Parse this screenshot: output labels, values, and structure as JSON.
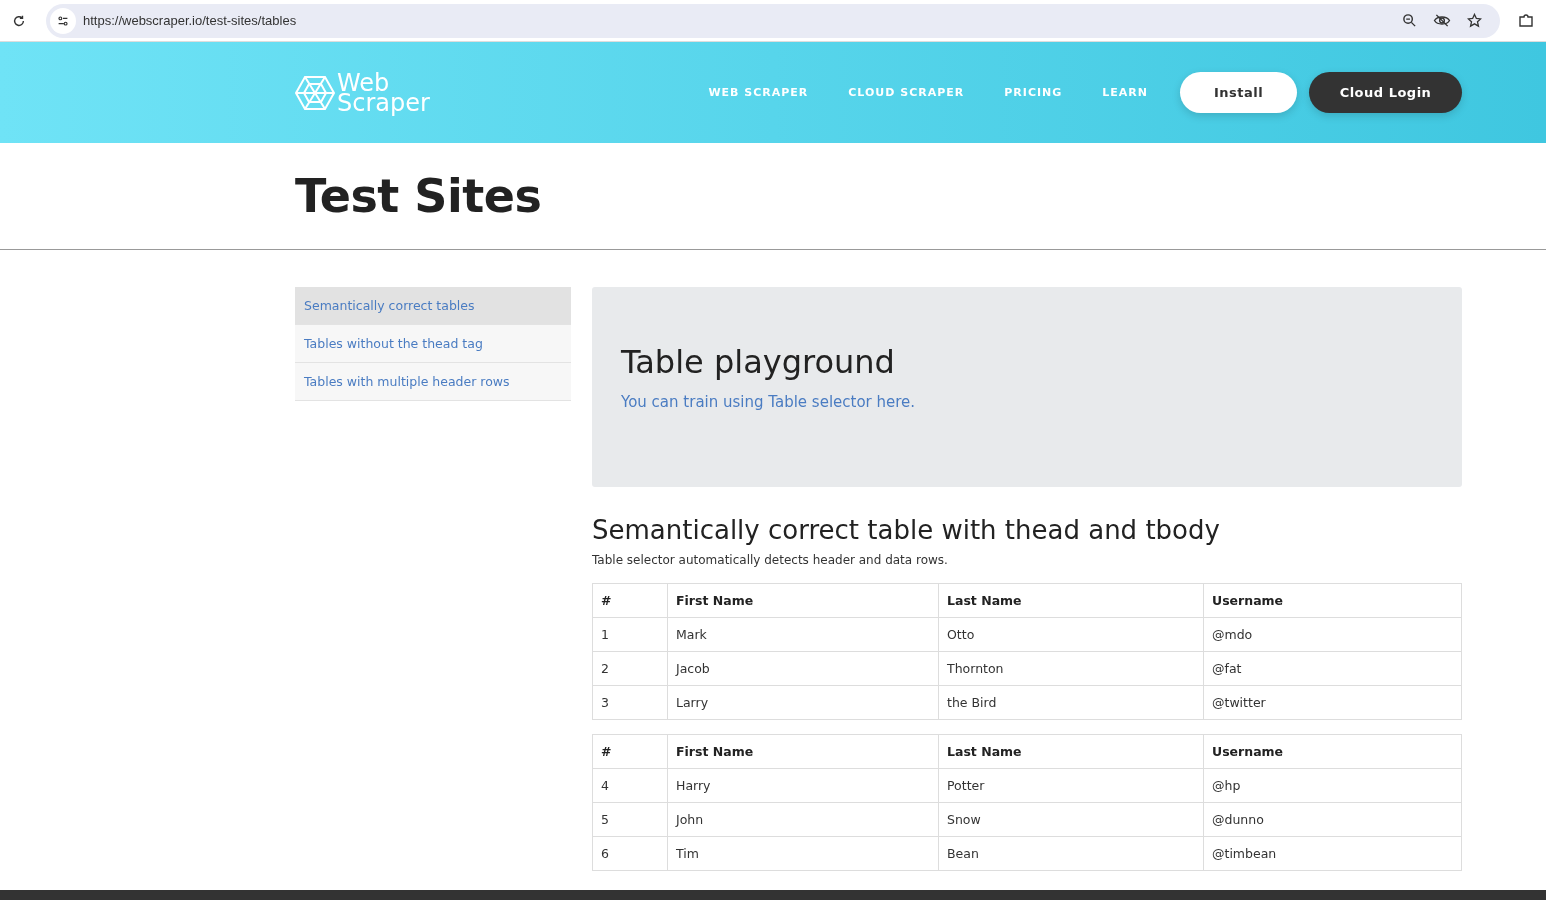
{
  "browser": {
    "url": "https://webscraper.io/test-sites/tables"
  },
  "header": {
    "logo": [
      "Web",
      "Scraper"
    ],
    "nav": [
      "WEB SCRAPER",
      "CLOUD SCRAPER",
      "PRICING",
      "LEARN"
    ],
    "install": "Install",
    "login": "Cloud Login"
  },
  "page_title": "Test Sites",
  "sidebar": {
    "items": [
      {
        "label": "Semantically correct tables",
        "selected": true
      },
      {
        "label": "Tables without the thead tag",
        "selected": false
      },
      {
        "label": "Tables with multiple header rows",
        "selected": false
      }
    ]
  },
  "jumbotron": {
    "title": "Table playground",
    "subtitle": "You can train using Table selector here."
  },
  "section": {
    "title": "Semantically correct table with thead and tbody",
    "description": "Table selector automatically detects header and data rows."
  },
  "tables": [
    {
      "columns": [
        "#",
        "First Name",
        "Last Name",
        "Username"
      ],
      "rows": [
        [
          "1",
          "Mark",
          "Otto",
          "@mdo"
        ],
        [
          "2",
          "Jacob",
          "Thornton",
          "@fat"
        ],
        [
          "3",
          "Larry",
          "the Bird",
          "@twitter"
        ]
      ]
    },
    {
      "columns": [
        "#",
        "First Name",
        "Last Name",
        "Username"
      ],
      "rows": [
        [
          "4",
          "Harry",
          "Potter",
          "@hp"
        ],
        [
          "5",
          "John",
          "Snow",
          "@dunno"
        ],
        [
          "6",
          "Tim",
          "Bean",
          "@timbean"
        ]
      ]
    }
  ]
}
